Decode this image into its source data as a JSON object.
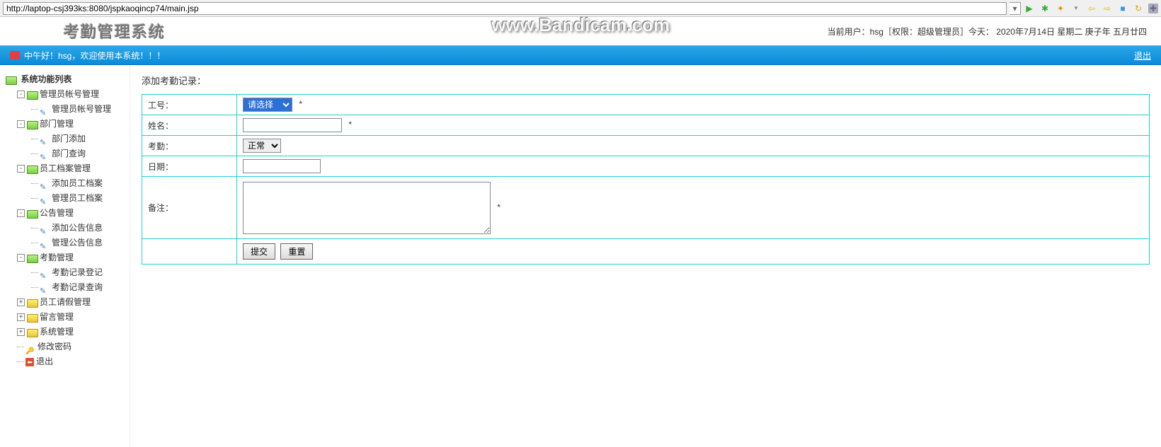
{
  "browser": {
    "url": "http://laptop-csj393ks:8080/jspkaoqincp74/main.jsp"
  },
  "header": {
    "app_title": "考勤管理系统",
    "watermark": "www.Bandicam.com",
    "user_info": "当前用户：hsg［权限：超级管理员］今天：  2020年7月14日  星期二  庚子年  五月廿四"
  },
  "greeting": {
    "text": "中午好！hsg，欢迎使用本系统！！！",
    "logout": "退出"
  },
  "sidebar": {
    "root": "系统功能列表",
    "nodes": [
      {
        "label": "管理员帐号管理",
        "open": true,
        "children": [
          {
            "label": "管理员帐号管理",
            "type": "leaf"
          }
        ]
      },
      {
        "label": "部门管理",
        "open": true,
        "children": [
          {
            "label": "部门添加",
            "type": "leaf"
          },
          {
            "label": "部门查询",
            "type": "leaf"
          }
        ]
      },
      {
        "label": "员工档案管理",
        "open": true,
        "children": [
          {
            "label": "添加员工档案",
            "type": "leaf"
          },
          {
            "label": "管理员工档案",
            "type": "leaf"
          }
        ]
      },
      {
        "label": "公告管理",
        "open": true,
        "children": [
          {
            "label": "添加公告信息",
            "type": "leaf"
          },
          {
            "label": "管理公告信息",
            "type": "leaf"
          }
        ]
      },
      {
        "label": "考勤管理",
        "open": true,
        "children": [
          {
            "label": "考勤记录登记",
            "type": "leaf"
          },
          {
            "label": "考勤记录查询",
            "type": "leaf"
          }
        ]
      },
      {
        "label": "员工请假管理",
        "open": false
      },
      {
        "label": "留言管理",
        "open": false
      },
      {
        "label": "系统管理",
        "open": false
      },
      {
        "label": "修改密码",
        "type": "key"
      },
      {
        "label": "退出",
        "type": "exit"
      }
    ]
  },
  "form": {
    "title": "添加考勤记录：",
    "fields": {
      "gonghao": {
        "label": "工号：",
        "value": "请选择",
        "required": "*"
      },
      "xingming": {
        "label": "姓名：",
        "value": "",
        "required": "*"
      },
      "kaoqin": {
        "label": "考勤：",
        "value": "正常"
      },
      "riqi": {
        "label": "日期：",
        "value": ""
      },
      "beizhu": {
        "label": "备注：",
        "value": "",
        "required": "*"
      }
    },
    "buttons": {
      "submit": "提交",
      "reset": "重置"
    }
  }
}
